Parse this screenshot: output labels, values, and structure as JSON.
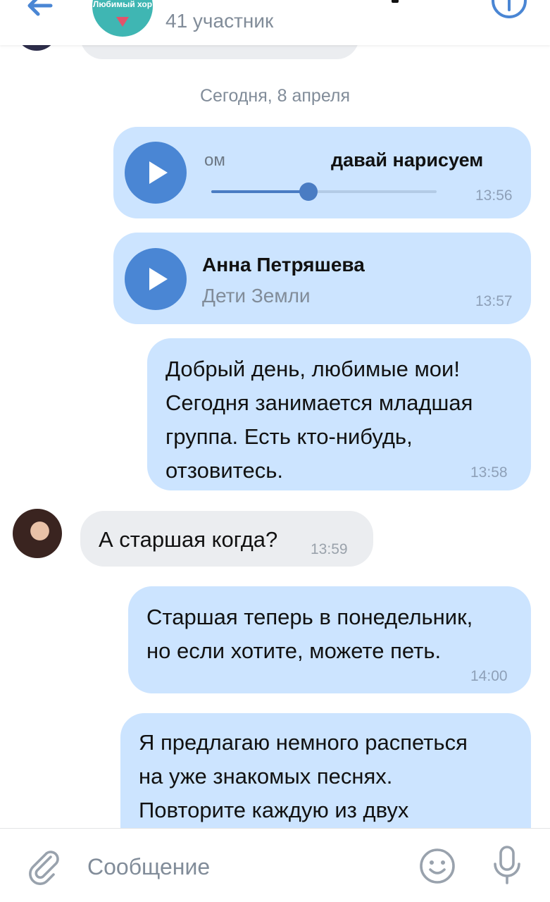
{
  "header": {
    "chat_avatar_text": "Любимый хор",
    "members_count": "41 участник",
    "icons": {
      "back": "arrow-left-icon",
      "info": "info-icon"
    }
  },
  "date_separator": "Сегодня, 8 апреля",
  "messages": [
    {
      "type": "music",
      "direction": "outgoing",
      "track_left": "ом",
      "track_title": "давай нарисуем",
      "progress": 0.43,
      "time": "13:56"
    },
    {
      "type": "audio",
      "direction": "outgoing",
      "artist": "Анна Петряшева",
      "title": "Дети Земли",
      "time": "13:57"
    },
    {
      "type": "text",
      "direction": "outgoing",
      "text": "Добрый день, любимые мои!\nСегодня занимается младшая\nгруппа. Есть кто-нибудь,\nотзовитесь.",
      "time": "13:58"
    },
    {
      "type": "text",
      "direction": "incoming",
      "text": "А старшая когда?",
      "time": "13:59"
    },
    {
      "type": "text",
      "direction": "outgoing",
      "text": "Старшая теперь в понедельник,\nно если хотите, можете петь.",
      "time": "14:00"
    },
    {
      "type": "text",
      "direction": "outgoing",
      "text": "Я предлагаю немного распеться\nна уже знакомых песнях.\nПовторите каждую из двух"
    }
  ],
  "composer": {
    "placeholder": "Сообщение",
    "icons": {
      "attach": "paperclip-icon",
      "emoji": "smile-icon",
      "mic": "microphone-icon"
    }
  },
  "colors": {
    "outgoing_bubble": "#cce4ff",
    "incoming_bubble": "#ebedf0",
    "accent": "#4a86d4",
    "secondary_text": "#818c99"
  }
}
